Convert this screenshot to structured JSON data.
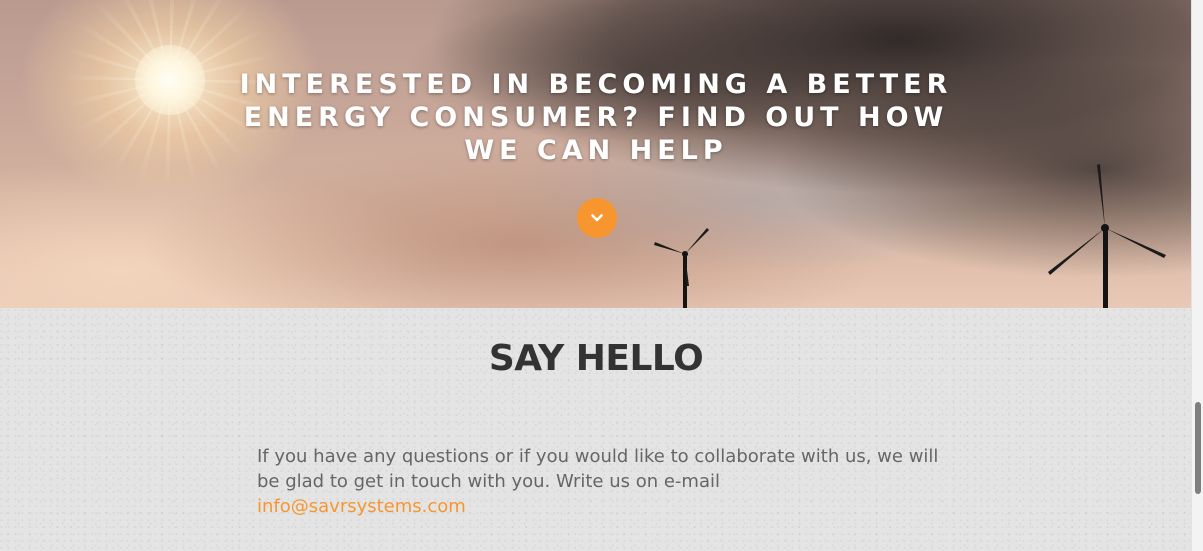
{
  "hero": {
    "title": "Interested in becoming a better energy consumer? Find out how we can help",
    "scroll_icon": "chevron-down-icon"
  },
  "contact": {
    "title": "SAY HELLO",
    "text": "If you have any questions or if you would like to collaborate with us, we will be glad to get in touch with you. Write us on e-mail",
    "email": "info@savrsystems.com"
  },
  "colors": {
    "accent": "#f7962f",
    "heading": "#333333",
    "body_text": "#666666",
    "section_background": "#e4e4e4"
  }
}
